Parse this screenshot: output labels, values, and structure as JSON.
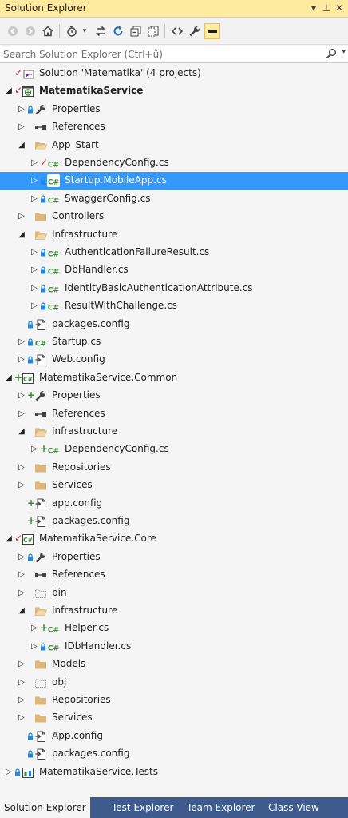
{
  "window": {
    "title": "Solution Explorer",
    "pin_glyph": "▾ ⊥ ✕"
  },
  "search": {
    "placeholder": "Search Solution Explorer (Ctrl+ů)"
  },
  "tree": [
    {
      "label": "Solution 'Matematika' (4 projects)",
      "icon": "solution-icon",
      "bold": false
    },
    {
      "label": "MatematikaService",
      "icon": "web-project-icon",
      "bold": true
    },
    {
      "label": "Properties",
      "icon": "wrench-icon"
    },
    {
      "label": "References",
      "icon": "references-icon"
    },
    {
      "label": "App_Start",
      "icon": "folder-open-icon"
    },
    {
      "label": "DependencyConfig.cs",
      "icon": "csharp-file-icon"
    },
    {
      "label": "Startup.MobileApp.cs",
      "icon": "csharp-file-icon"
    },
    {
      "label": "SwaggerConfig.cs",
      "icon": "csharp-file-icon"
    },
    {
      "label": "Controllers",
      "icon": "folder-icon"
    },
    {
      "label": "Infrastructure",
      "icon": "folder-open-icon"
    },
    {
      "label": "AuthenticationFailureResult.cs",
      "icon": "csharp-file-icon"
    },
    {
      "label": "DbHandler.cs",
      "icon": "csharp-file-icon"
    },
    {
      "label": "IdentityBasicAuthenticationAttribute.cs",
      "icon": "csharp-file-icon"
    },
    {
      "label": "ResultWithChallenge.cs",
      "icon": "csharp-file-icon"
    },
    {
      "label": "packages.config",
      "icon": "config-file-icon"
    },
    {
      "label": "Startup.cs",
      "icon": "csharp-file-icon"
    },
    {
      "label": "Web.config",
      "icon": "config-file-icon"
    },
    {
      "label": "MatematikaService.Common",
      "icon": "csharp-project-icon"
    },
    {
      "label": "Properties",
      "icon": "wrench-icon"
    },
    {
      "label": "References",
      "icon": "references-icon"
    },
    {
      "label": "Infrastructure",
      "icon": "folder-open-icon"
    },
    {
      "label": "DependencyConfig.cs",
      "icon": "csharp-file-icon"
    },
    {
      "label": "Repositories",
      "icon": "folder-icon"
    },
    {
      "label": "Services",
      "icon": "folder-icon"
    },
    {
      "label": "app.config",
      "icon": "config-file-icon"
    },
    {
      "label": "packages.config",
      "icon": "config-file-icon"
    },
    {
      "label": "MatematikaService.Core",
      "icon": "csharp-project-icon"
    },
    {
      "label": "Properties",
      "icon": "wrench-icon"
    },
    {
      "label": "References",
      "icon": "references-icon"
    },
    {
      "label": "bin",
      "icon": "folder-excluded-icon"
    },
    {
      "label": "Infrastructure",
      "icon": "folder-open-icon"
    },
    {
      "label": "Helper.cs",
      "icon": "csharp-file-icon"
    },
    {
      "label": "IDbHandler.cs",
      "icon": "csharp-file-icon"
    },
    {
      "label": "Models",
      "icon": "folder-icon"
    },
    {
      "label": "obj",
      "icon": "folder-excluded-icon"
    },
    {
      "label": "Repositories",
      "icon": "folder-icon"
    },
    {
      "label": "Services",
      "icon": "folder-icon"
    },
    {
      "label": "App.config",
      "icon": "config-file-icon"
    },
    {
      "label": "packages.config",
      "icon": "config-file-icon"
    },
    {
      "label": "MatematikaService.Tests",
      "icon": "test-project-icon"
    }
  ],
  "selected_item": "Startup.MobileApp.cs",
  "bottom_tabs": [
    {
      "label": "Solution Explorer",
      "active": true
    },
    {
      "label": "Test Explorer",
      "active": false
    },
    {
      "label": "Team Explorer",
      "active": false
    },
    {
      "label": "Class View",
      "active": false
    }
  ],
  "colors": {
    "title_bar": "#ffeaa0",
    "selection": "#3399ff",
    "tab_strip": "#3f5b8e",
    "folder": "#dcb67a",
    "csharp": "#388a34",
    "checked_in_lock": "#1e88e5",
    "pending_add": "#388a34",
    "pending_edit": "#d11a1a"
  }
}
